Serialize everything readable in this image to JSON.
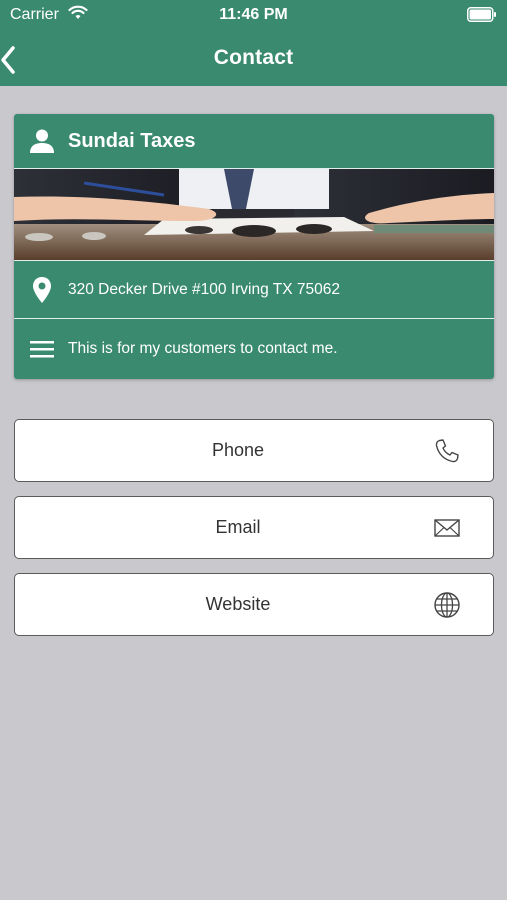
{
  "status_bar": {
    "carrier": "Carrier",
    "time": "11:46 PM"
  },
  "nav": {
    "title": "Contact"
  },
  "card": {
    "business_name": "Sundai Taxes",
    "address": "320 Decker Drive #100 Irving TX 75062",
    "description": "This is for my customers to contact me."
  },
  "actions": [
    {
      "label": "Phone",
      "icon": "phone-icon"
    },
    {
      "label": "Email",
      "icon": "envelope-icon"
    },
    {
      "label": "Website",
      "icon": "globe-icon"
    }
  ],
  "colors": {
    "accent": "#3a8a70",
    "background": "#c9c8cd"
  }
}
